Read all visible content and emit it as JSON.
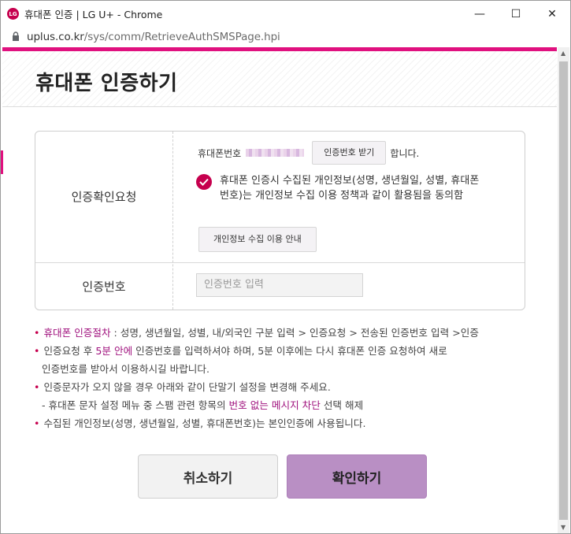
{
  "window": {
    "title": "휴대폰 인증 | LG U+ - Chrome",
    "logo_text": "LG",
    "controls": {
      "minimize": "—",
      "maximize": "☐",
      "close": "✕"
    }
  },
  "address": {
    "host": "uplus.co.kr",
    "path": "/sys/comm/RetrieveAuthSMSPage.hpi",
    "lock_icon": "lock-icon"
  },
  "header": {
    "title": "휴대폰 인증하기"
  },
  "form": {
    "row1_label": "인증확인요청",
    "phone_label": "휴대폰번호",
    "request_button": "인증번호 받기",
    "phone_suffix": "합니다.",
    "consent_text": "휴대폰 인증시 수집된 개인정보(성명, 생년월일, 성별, 휴대폰번호)는 개인정보 수집 이용 정책과 같이 활용됨을 동의함",
    "consent_checked": true,
    "privacy_button": "개인정보 수집 이용 안내",
    "row2_label": "인증번호",
    "code_placeholder": "인증번호 입력"
  },
  "notes": {
    "n1_highlight": "휴대폰 인증절차",
    "n1_rest": " : 성명, 생년월일, 성별, 내/외국인 구분 입력 > 인증요청 > 전송된 인증번호 입력 >인증",
    "n2_a": "인증요청 후 ",
    "n2_highlight": "5분 안에",
    "n2_b": " 인증번호를 입력하셔야 하며, 5분 이후에는 다시 휴대폰 인증 요청하여 새로",
    "n2_c": "인증번호를 받아서 이용하시길 바랍니다.",
    "n3": "인증문자가 오지 않을 경우 아래와 같이 단말기 설정을 변경해 주세요.",
    "n3_sub_a": "- 휴대폰 문자 설정 메뉴 중 스팸 관련 항목의 ",
    "n3_sub_highlight": "번호 없는 메시지 차단",
    "n3_sub_b": " 선택 해제",
    "n4": "수집된 개인정보(성명, 생년월일, 성별, 휴대폰번호)는 본인인증에 사용됩니다."
  },
  "buttons": {
    "cancel": "취소하기",
    "confirm": "확인하기"
  },
  "colors": {
    "brand": "#c6004e",
    "accent_bar": "#e0117f",
    "confirm_bg": "#b98fc4"
  }
}
